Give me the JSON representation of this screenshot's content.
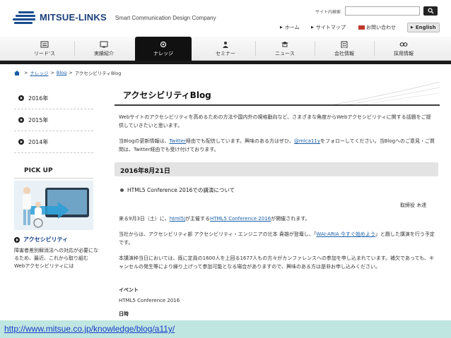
{
  "header": {
    "logo_name": "MITSUE-LINKS",
    "logo_tagline": "Smart Communication Design Company",
    "search_label": "サイト内検索",
    "search_placeholder": "",
    "utility": {
      "home": "ホーム",
      "sitemap": "サイトマップ",
      "contact": "お問い合わせ",
      "lang": "English"
    }
  },
  "nav": {
    "items": [
      {
        "label": "リード'ス",
        "icon": "lead-icon"
      },
      {
        "label": "実績紹介",
        "icon": "works-icon"
      },
      {
        "label": "ナレッジ",
        "icon": "knowledge-icon"
      },
      {
        "label": "セミナー",
        "icon": "seminar-icon"
      },
      {
        "label": "ニュース",
        "icon": "news-icon"
      },
      {
        "label": "会社情報",
        "icon": "company-icon"
      },
      {
        "label": "採用情報",
        "icon": "recruit-icon"
      }
    ],
    "active_index": 2
  },
  "breadcrumb": {
    "items": [
      "ナレッジ",
      "Blog",
      "アクセシビリティBlog"
    ]
  },
  "sidebar": {
    "years": [
      "2016年",
      "2015年",
      "2014年"
    ],
    "pickup_title": "PICK UP",
    "pickup_link": "アクセシビリティ",
    "pickup_desc": "障害者差別解消法への対応が必要になるため、最近、これから取り組むWebアクセシビリティには"
  },
  "main": {
    "title": "アクセシビリティBlog",
    "intro_1": "Webサイトのアクセシビリティを高めるための方法や国内外の規格動向など、さまざまな角度からWebアクセシビリティに関する話題をご提供していきたいと思います。",
    "intro_2_a": "当Blogの更新情報は、",
    "intro_2_link1": "Twitter",
    "intro_2_b": "経由でも配信しています。興味のある方はぜひ、",
    "intro_2_link2": "@mlca11y",
    "intro_2_c": "をフォローしてください。当Blogへのご意見・ご質問は、Twitter経由でも受け付けております。",
    "date": "2016年8月21日",
    "entry_title": "HTML5 Conference 2016での講演について",
    "entry_author": "取締役 木達",
    "p1_a": "来る9月3日（土）に、",
    "p1_link1": "html5j",
    "p1_b": "が主催する",
    "p1_link2": "HTML5 Conference 2016",
    "p1_c": "が開催されます。",
    "p2_a": "当社からは、アクセシビリティ部 アクセシビリティ・エンジニアの辻本 貴雄が登壇し、「",
    "p2_link": "WAI-ARIA 今すぐ始めよう",
    "p2_b": "」と題した講演を行う予定です。",
    "p3": "本講演枠当日においては、既に定員の1600人を上回る1677人もの方々がカンファレンスへの参加を申し込まれています。補欠であっても、キャンセルの発生等により繰り上げって参加可能となる場合がありますので、興味のある方は是非お申し込みください。",
    "event_label": "イベント",
    "event_value": "HTML5 Conference 2016",
    "date_label": "日時"
  },
  "banner": {
    "url": "http://www.mitsue.co.jp/knowledge/blog/a11y/"
  }
}
